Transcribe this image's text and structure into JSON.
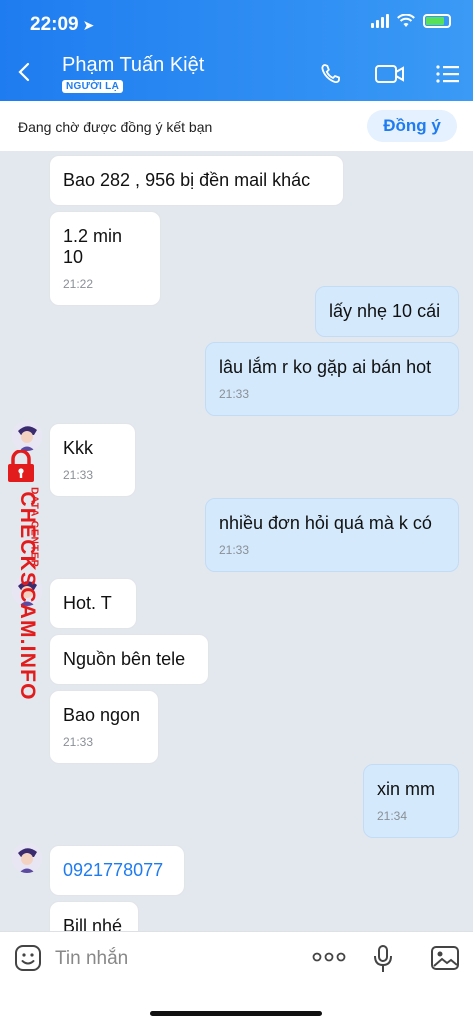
{
  "status": {
    "time": "22:09"
  },
  "header": {
    "contact_name": "Phạm Tuấn Kiệt",
    "badge": "NGƯỜI LẠ"
  },
  "pending": {
    "text": "Đang chờ được đồng ý kết bạn",
    "accept_label": "Đồng ý"
  },
  "messages": [
    {
      "text": "Bao 282 , 956 bị đền mail khác"
    },
    {
      "text": "1.2 min 10",
      "time": "21:22"
    },
    {
      "text": "lấy nhẹ 10 cái"
    },
    {
      "text": "lâu lắm r ko gặp ai bán hot",
      "time": "21:33"
    },
    {
      "text": "Kkk",
      "time": "21:33"
    },
    {
      "text": "nhiều đơn hỏi quá mà k có",
      "time": "21:33"
    },
    {
      "text": "Hot. T"
    },
    {
      "text": "Nguồn bên tele"
    },
    {
      "text": "Bao ngon",
      "time": "21:33"
    },
    {
      "text": "xin mm",
      "time": "21:34"
    },
    {
      "text": "0921778077"
    },
    {
      "text": "Bill nhé"
    }
  ],
  "watermark": {
    "main": "CHECKSCAM.INFO",
    "sub": "DATA CENTER"
  },
  "input": {
    "placeholder": "Tin nhắn"
  },
  "colors": {
    "brand": "#1f7cf0",
    "incoming": "#ffffff",
    "outgoing": "#d4e9fc",
    "watermark": "#e21c1c"
  }
}
